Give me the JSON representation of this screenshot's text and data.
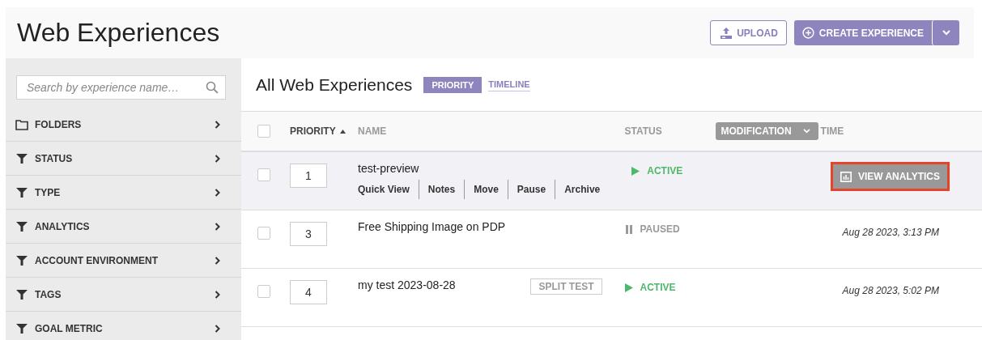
{
  "header": {
    "title": "Web Experiences",
    "upload_button": "UPLOAD",
    "create_button": "CREATE EXPERIENCE"
  },
  "sidebar": {
    "search": {
      "placeholder": "Search by experience name…"
    },
    "items": [
      {
        "label": "FOLDERS",
        "kind": "folder"
      },
      {
        "label": "STATUS",
        "kind": "filter"
      },
      {
        "label": "TYPE",
        "kind": "filter"
      },
      {
        "label": "ANALYTICS",
        "kind": "filter"
      },
      {
        "label": "ACCOUNT ENVIRONMENT",
        "kind": "filter"
      },
      {
        "label": "TAGS",
        "kind": "filter"
      },
      {
        "label": "GOAL METRIC",
        "kind": "filter"
      }
    ]
  },
  "main": {
    "title": "All Web Experiences",
    "views": [
      {
        "label": "PRIORITY",
        "selected": true
      },
      {
        "label": "TIMELINE",
        "selected": false
      }
    ],
    "table": {
      "all_checked": false,
      "columns": {
        "priority": "PRIORITY",
        "name": "NAME",
        "status": "STATUS",
        "sort_field": "MODIFICATION",
        "time": "TIME"
      },
      "rows": [
        {
          "checked": false,
          "selected": true,
          "priority": "1",
          "name": "test-preview",
          "actions": [
            "Quick View",
            "Notes",
            "Move",
            "Pause",
            "Archive"
          ],
          "status": {
            "label": "ACTIVE",
            "kind": "active"
          },
          "analytics_button": "VIEW ANALYTICS"
        },
        {
          "checked": false,
          "selected": false,
          "priority": "3",
          "name": "Free Shipping Image on PDP",
          "status": {
            "label": "PAUSED",
            "kind": "paused"
          },
          "time": "Aug 28 2023, 3:13 PM"
        },
        {
          "checked": false,
          "selected": false,
          "priority": "4",
          "name": "my test 2023-08-28",
          "tag": "SPLIT TEST",
          "status": {
            "label": "ACTIVE",
            "kind": "active"
          },
          "time": "Aug 28 2023, 5:02 PM"
        }
      ]
    }
  }
}
